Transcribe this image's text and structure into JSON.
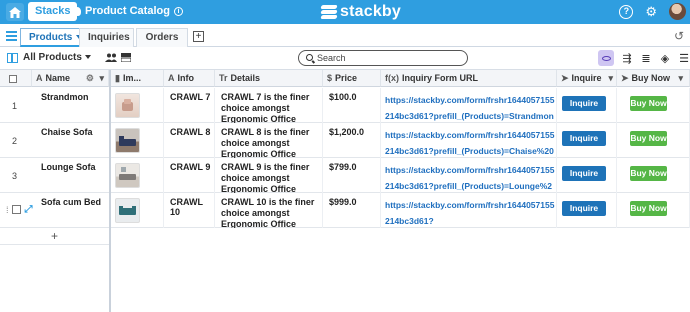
{
  "topbar": {
    "stacks_label": "Stacks",
    "stack_name": "Product Catalog",
    "brand": "stackby",
    "help_label": "?",
    "settings_label": "⚙"
  },
  "tabs": [
    {
      "label": "Products",
      "active": true
    },
    {
      "label": "Inquiries",
      "active": false
    },
    {
      "label": "Orders",
      "active": false
    }
  ],
  "add_tab_label": "+",
  "toolbar": {
    "view_label": "All Products",
    "search_placeholder": "Search"
  },
  "columns": [
    {
      "key": "name",
      "label": "Name",
      "icon": "text-icon"
    },
    {
      "key": "image",
      "label": "Im...",
      "icon": "attachment-icon"
    },
    {
      "key": "info",
      "label": "Info",
      "icon": "text-icon"
    },
    {
      "key": "details",
      "label": "Details",
      "icon": "long-text-icon"
    },
    {
      "key": "price",
      "label": "Price",
      "icon": "currency-icon"
    },
    {
      "key": "url",
      "label": "Inquiry Form URL",
      "icon": "formula-icon"
    },
    {
      "key": "inquire",
      "label": "Inquire",
      "icon": "cursor-icon"
    },
    {
      "key": "buy",
      "label": "Buy Now",
      "icon": "cursor-icon"
    }
  ],
  "column_icons": {
    "name": "A",
    "image": "▮",
    "info": "A",
    "details": "Tr",
    "price": "$",
    "url": "f(x)",
    "inquire": "➤",
    "buy": "➤"
  },
  "rows": [
    {
      "num": "1",
      "name": "Strandmon",
      "info": "CRAWL 7",
      "details": "CRAWL 7 is the finer choice amongst Ergonomic Office Chairs to be used in any",
      "price": "$100.0",
      "url": "https://stackby.com/form/frshr1644057155214bc3d61?prefill_(Products)=Strandmon",
      "inquire": "Inquire Now",
      "buy": "Buy Now",
      "thumb_color": "#e9d7cc"
    },
    {
      "num": "2",
      "name": "Chaise Sofa",
      "info": "CRAWL 8",
      "details": "CRAWL 8 is the finer choice amongst Ergonomic Office Chairs to be used in any",
      "price": "$1,200.0",
      "url": "https://stackby.com/form/frshr1644057155214bc3d61?prefill_(Products)=Chaise%20Sofa%20",
      "inquire": "Inquire Now",
      "buy": "Buy Now",
      "thumb_color": "#3d4a6b"
    },
    {
      "num": "3",
      "name": "Lounge Sofa",
      "info": "CRAWL 9",
      "details": "CRAWL 9 is the finer choice amongst Ergonomic Office Chairs to be used in any",
      "price": "$799.0",
      "url": "https://stackby.com/form/frshr1644057155214bc3d61?prefill_(Products)=Lounge%20Sofa%20",
      "inquire": "Inquire Now",
      "buy": "Buy Now",
      "thumb_color": "#c8c2bd"
    },
    {
      "num": "",
      "name": "Sofa cum Bed",
      "info": "CRAWL 10",
      "details": "CRAWL 10 is the finer choice amongst Ergonomic Office Chairs to be used in any",
      "price": "$999.0",
      "url": "https://stackby.com/form/frshr1644057155214bc3d61?",
      "inquire": "Inquire Now",
      "buy": "Buy Now",
      "thumb_color": "#2f6f78"
    }
  ],
  "add_row_label": "+"
}
